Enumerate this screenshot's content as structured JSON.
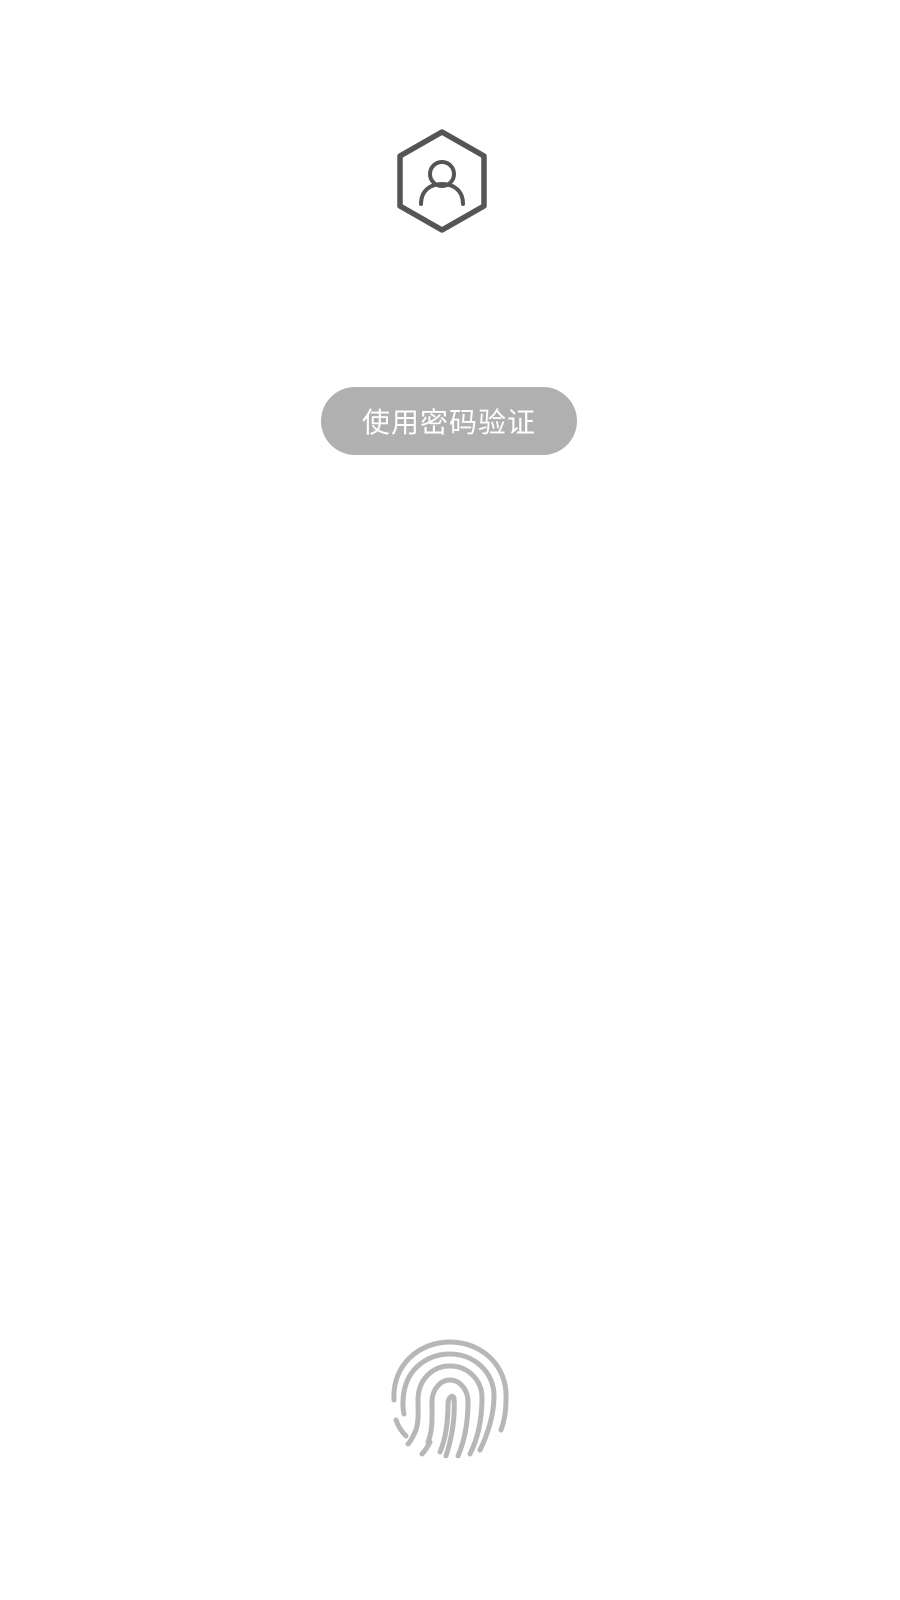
{
  "lock_screen": {
    "avatar_icon": "hexagon-user-icon",
    "password_button_label": "使用密码验证",
    "fingerprint_icon": "fingerprint-icon"
  },
  "colors": {
    "background": "#ffffff",
    "avatar_stroke": "#555555",
    "button_fill": "#b0b0b0",
    "button_text": "#ffffff",
    "fingerprint_stroke": "#b7b7b7"
  }
}
